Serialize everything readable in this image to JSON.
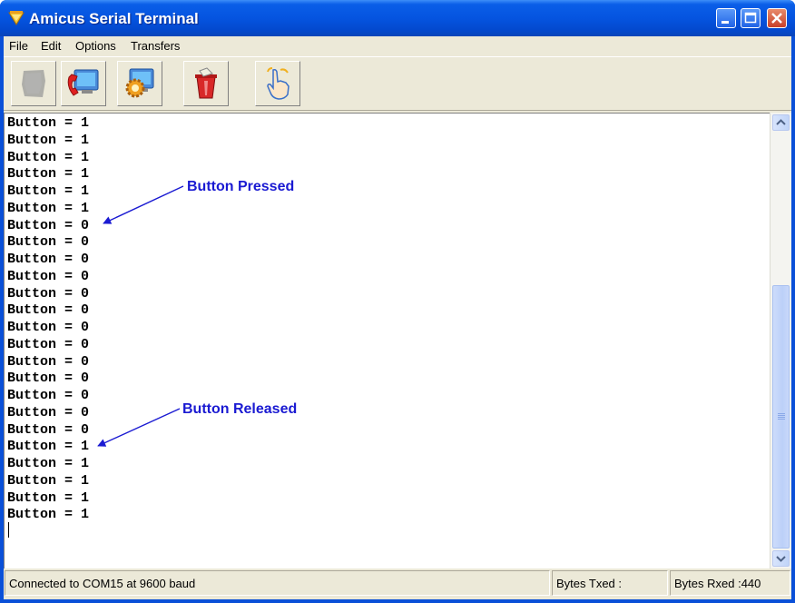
{
  "window": {
    "title": "Amicus Serial Terminal",
    "controls": [
      "minimize",
      "maximize",
      "close"
    ]
  },
  "menu": {
    "items": [
      "File",
      "Edit",
      "Options",
      "Transfers"
    ]
  },
  "toolbar": {
    "buttons": [
      {
        "icon": "disconnected-icon",
        "enabled": false
      },
      {
        "icon": "connect-phone-icon",
        "enabled": true
      },
      {
        "icon": "settings-gear-icon",
        "enabled": true
      },
      {
        "icon": "clear-bin-icon",
        "enabled": true
      },
      {
        "icon": "pointer-hand-icon",
        "enabled": true
      }
    ]
  },
  "terminal": {
    "lines": [
      "Button = 1",
      "Button = 1",
      "Button = 1",
      "Button = 1",
      "Button = 1",
      "Button = 1",
      "Button = 0",
      "Button = 0",
      "Button = 0",
      "Button = 0",
      "Button = 0",
      "Button = 0",
      "Button = 0",
      "Button = 0",
      "Button = 0",
      "Button = 0",
      "Button = 0",
      "Button = 0",
      "Button = 0",
      "Button = 1",
      "Button = 1",
      "Button = 1",
      "Button = 1",
      "Button = 1"
    ],
    "annotations": {
      "pressed": "Button Pressed",
      "released": "Button Released"
    }
  },
  "scrollbar": {
    "position_fraction": 0.4
  },
  "status": {
    "connection": "Connected to COM15 at 9600 baud",
    "bytes_txed": "Bytes Txed :",
    "bytes_rxed": "Bytes Rxed :440"
  },
  "colors": {
    "titlebar": "#0554e0",
    "annotation": "#1a1ad2",
    "window_face": "#ece9d8"
  }
}
